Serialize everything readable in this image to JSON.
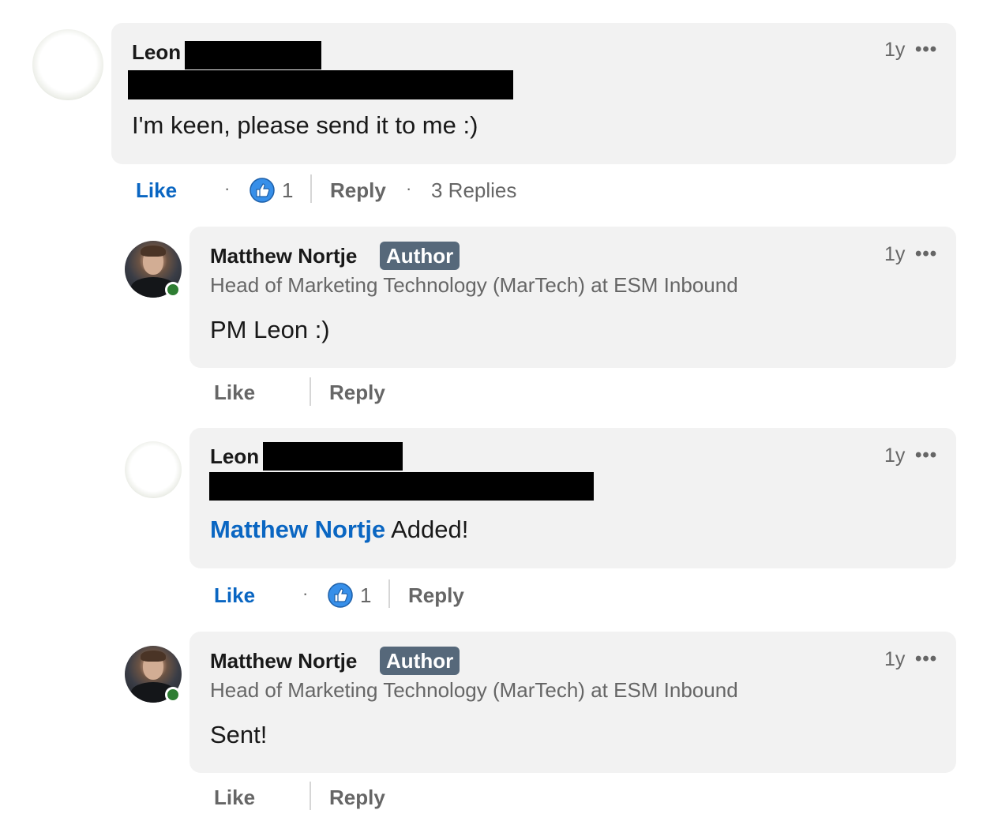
{
  "comments": [
    {
      "author": "Leon",
      "body": "I'm keen, please send it to me :)",
      "time": "1y",
      "more": "•••",
      "actions": {
        "like": "Like",
        "reaction_count": "1",
        "reply": "Reply",
        "replies": "3 Replies"
      }
    },
    {
      "author": "Matthew Nortje",
      "badge": "Author",
      "headline": "Head of Marketing Technology (MarTech) at ESM Inbound",
      "body": "PM Leon :)",
      "time": "1y",
      "more": "•••",
      "actions": {
        "like": "Like",
        "reply": "Reply"
      }
    },
    {
      "author": "Leon",
      "mention": "Matthew Nortje",
      "body": " Added!",
      "time": "1y",
      "more": "•••",
      "actions": {
        "like": "Like",
        "reaction_count": "1",
        "reply": "Reply"
      }
    },
    {
      "author": "Matthew Nortje",
      "badge": "Author",
      "headline": "Head of Marketing Technology (MarTech) at ESM Inbound",
      "body": "Sent!",
      "time": "1y",
      "more": "•••",
      "actions": {
        "like": "Like",
        "reply": "Reply"
      }
    }
  ],
  "colors": {
    "bubble": "#f2f2f2",
    "accent": "#0a66c2",
    "badge": "#56687a",
    "presence": "#2e7d32"
  },
  "icons": {
    "reaction": "thumbs-up-icon",
    "more": "more-options-icon"
  }
}
